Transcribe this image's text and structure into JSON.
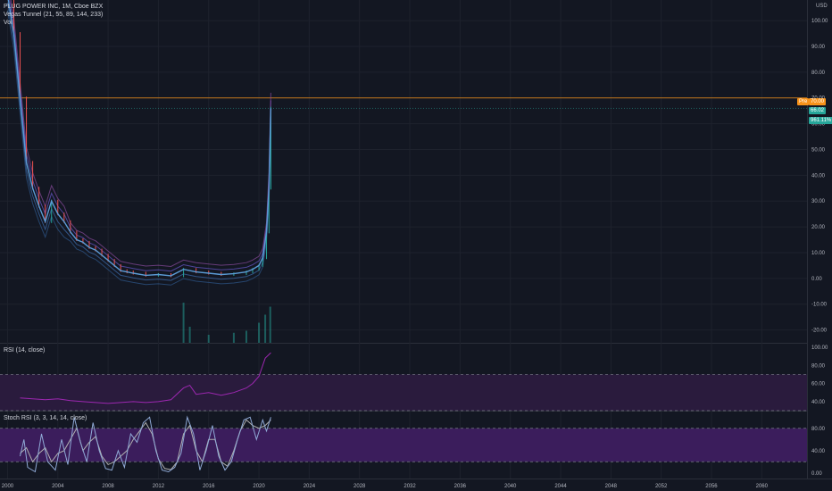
{
  "main_legend": {
    "symbol": "PLUG POWER INC, 1M, Cboe BZX",
    "indicator": "Vegas Tunnel (21, 55, 89, 144, 233)",
    "volume": "Vol"
  },
  "currency": "USD",
  "rsi_legend": "RSI (14, close)",
  "stoch_legend": "Stoch RSI (3, 3, 14, 14, close)",
  "price_tags": {
    "pre_label": "Pre",
    "pre_value": "70.00",
    "last_value": "66.02",
    "change_value": "961.11%"
  },
  "colors": {
    "background": "#131722",
    "grid": "#1e222d",
    "up": "#26a69a",
    "down": "#ef5350",
    "tunnel": "#5b9bd5",
    "pre_line": "#f7931a",
    "rsi_line": "#9c27b0",
    "rsi_band": "#2a1b3d",
    "stoch_k": "#8fa9d6",
    "stoch_d": "#b0b0b0",
    "stoch_band": "#3b1d5c"
  },
  "chart_data": [
    {
      "type": "line",
      "panel": "price",
      "series": [
        {
          "name": "",
          "values": [
            [
              2000.0,
              110
            ],
            [
              2000.5,
              95
            ],
            [
              2001.0,
              70
            ],
            [
              2001.5,
              45
            ],
            [
              2002.0,
              35
            ],
            [
              2002.5,
              28
            ],
            [
              2003.0,
              22
            ],
            [
              2003.5,
              30
            ],
            [
              2004.0,
              25
            ],
            [
              2004.5,
              22
            ],
            [
              2005.0,
              18
            ],
            [
              2005.5,
              15
            ],
            [
              2006.0,
              14
            ],
            [
              2006.5,
              12
            ],
            [
              2007.0,
              11
            ],
            [
              2007.5,
              9
            ],
            [
              2008.0,
              7
            ],
            [
              2008.5,
              5
            ],
            [
              2009.0,
              3
            ],
            [
              2009.5,
              2.5
            ],
            [
              2010.0,
              2
            ],
            [
              2011.0,
              1.2
            ],
            [
              2012.0,
              1.5
            ],
            [
              2013.0,
              1.0
            ],
            [
              2014.0,
              3.5
            ],
            [
              2015.0,
              2.5
            ],
            [
              2016.0,
              2.0
            ],
            [
              2017.0,
              1.5
            ],
            [
              2018.0,
              1.8
            ],
            [
              2019.0,
              2.5
            ],
            [
              2019.5,
              3.5
            ],
            [
              2020.0,
              5
            ],
            [
              2020.3,
              8
            ],
            [
              2020.6,
              18
            ],
            [
              2020.8,
              35
            ],
            [
              2020.95,
              66.02
            ]
          ]
        }
      ],
      "pre_market": 70.0,
      "volume": [
        [
          2014.0,
          1.0
        ],
        [
          2014.5,
          0.4
        ],
        [
          2016.0,
          0.2
        ],
        [
          2018.0,
          0.25
        ],
        [
          2019.0,
          0.3
        ],
        [
          2020.0,
          0.5
        ],
        [
          2020.5,
          0.7
        ],
        [
          2020.9,
          0.9
        ]
      ],
      "xlim": [
        1999.4,
        2063.6
      ],
      "x_ticks": [
        "2000",
        "2004",
        "2008",
        "2012",
        "2016",
        "2020",
        "2024",
        "2028",
        "2032",
        "2036",
        "2040",
        "2044",
        "2048",
        "2052",
        "2056",
        "2060"
      ],
      "ylim": [
        -25,
        108
      ],
      "y_ticks": [
        "100.00",
        "90.00",
        "80.00",
        "70.00",
        "60.00",
        "50.00",
        "40.00",
        "30.00",
        "20.00",
        "10.00",
        "0.00",
        "-10.00",
        "-20.00"
      ],
      "grid": true
    },
    {
      "type": "line",
      "panel": "rsi",
      "series": [
        {
          "name": "",
          "values": [
            [
              2001.0,
              44
            ],
            [
              2002.0,
              43
            ],
            [
              2003.0,
              42
            ],
            [
              2004.0,
              43
            ],
            [
              2005.0,
              41
            ],
            [
              2006.0,
              40
            ],
            [
              2007.0,
              39
            ],
            [
              2008.0,
              38
            ],
            [
              2009.0,
              39
            ],
            [
              2010.0,
              40
            ],
            [
              2011.0,
              39
            ],
            [
              2012.0,
              40
            ],
            [
              2013.0,
              42
            ],
            [
              2014.0,
              55
            ],
            [
              2014.5,
              58
            ],
            [
              2015.0,
              48
            ],
            [
              2016.0,
              50
            ],
            [
              2017.0,
              47
            ],
            [
              2018.0,
              50
            ],
            [
              2019.0,
              55
            ],
            [
              2019.5,
              60
            ],
            [
              2020.0,
              68
            ],
            [
              2020.5,
              88
            ],
            [
              2020.95,
              94
            ]
          ]
        }
      ],
      "ylim": [
        30,
        100
      ],
      "y_ticks": [
        "100.00",
        "80.00",
        "60.00",
        "40.00"
      ],
      "bands": [
        30,
        70
      ]
    },
    {
      "type": "line",
      "panel": "stoch_rsi",
      "series": [
        {
          "name": "",
          "values": [
            [
              2001.0,
              30
            ],
            [
              2001.3,
              60
            ],
            [
              2001.6,
              10
            ],
            [
              2002.2,
              2
            ],
            [
              2002.7,
              70
            ],
            [
              2003.2,
              20
            ],
            [
              2003.8,
              5
            ],
            [
              2004.3,
              60
            ],
            [
              2004.8,
              15
            ],
            [
              2005.3,
              100
            ],
            [
              2005.8,
              55
            ],
            [
              2006.3,
              20
            ],
            [
              2006.8,
              90
            ],
            [
              2007.3,
              40
            ],
            [
              2007.8,
              8
            ],
            [
              2008.3,
              5
            ],
            [
              2008.8,
              40
            ],
            [
              2009.3,
              10
            ],
            [
              2009.8,
              70
            ],
            [
              2010.3,
              55
            ],
            [
              2010.8,
              90
            ],
            [
              2011.3,
              100
            ],
            [
              2011.8,
              40
            ],
            [
              2012.3,
              5
            ],
            [
              2012.8,
              2
            ],
            [
              2013.3,
              10
            ],
            [
              2013.8,
              35
            ],
            [
              2014.3,
              100
            ],
            [
              2014.8,
              70
            ],
            [
              2015.3,
              5
            ],
            [
              2015.8,
              40
            ],
            [
              2016.3,
              85
            ],
            [
              2016.8,
              30
            ],
            [
              2017.3,
              5
            ],
            [
              2017.8,
              20
            ],
            [
              2018.3,
              60
            ],
            [
              2018.8,
              95
            ],
            [
              2019.3,
              100
            ],
            [
              2019.8,
              60
            ],
            [
              2020.3,
              95
            ],
            [
              2020.6,
              75
            ],
            [
              2020.95,
              100
            ]
          ]
        },
        {
          "name": "",
          "values": [
            [
              2001.0,
              35
            ],
            [
              2001.5,
              45
            ],
            [
              2002.0,
              20
            ],
            [
              2002.5,
              35
            ],
            [
              2003.0,
              45
            ],
            [
              2003.5,
              20
            ],
            [
              2004.0,
              35
            ],
            [
              2004.5,
              40
            ],
            [
              2005.0,
              60
            ],
            [
              2005.5,
              80
            ],
            [
              2006.0,
              40
            ],
            [
              2006.5,
              55
            ],
            [
              2007.0,
              65
            ],
            [
              2007.5,
              30
            ],
            [
              2008.0,
              15
            ],
            [
              2008.5,
              20
            ],
            [
              2009.0,
              30
            ],
            [
              2009.5,
              40
            ],
            [
              2010.0,
              60
            ],
            [
              2010.5,
              75
            ],
            [
              2011.0,
              90
            ],
            [
              2011.5,
              70
            ],
            [
              2012.0,
              25
            ],
            [
              2012.5,
              8
            ],
            [
              2013.0,
              6
            ],
            [
              2013.5,
              20
            ],
            [
              2014.0,
              70
            ],
            [
              2014.5,
              85
            ],
            [
              2015.0,
              40
            ],
            [
              2015.5,
              20
            ],
            [
              2016.0,
              60
            ],
            [
              2016.5,
              60
            ],
            [
              2017.0,
              20
            ],
            [
              2017.5,
              12
            ],
            [
              2018.0,
              40
            ],
            [
              2018.5,
              75
            ],
            [
              2019.0,
              95
            ],
            [
              2019.5,
              85
            ],
            [
              2020.0,
              80
            ],
            [
              2020.5,
              85
            ],
            [
              2020.95,
              95
            ]
          ]
        }
      ],
      "ylim": [
        -10,
        110
      ],
      "y_ticks": [
        "80.00",
        "40.00",
        "0.00"
      ],
      "bands": [
        20,
        80
      ]
    }
  ]
}
